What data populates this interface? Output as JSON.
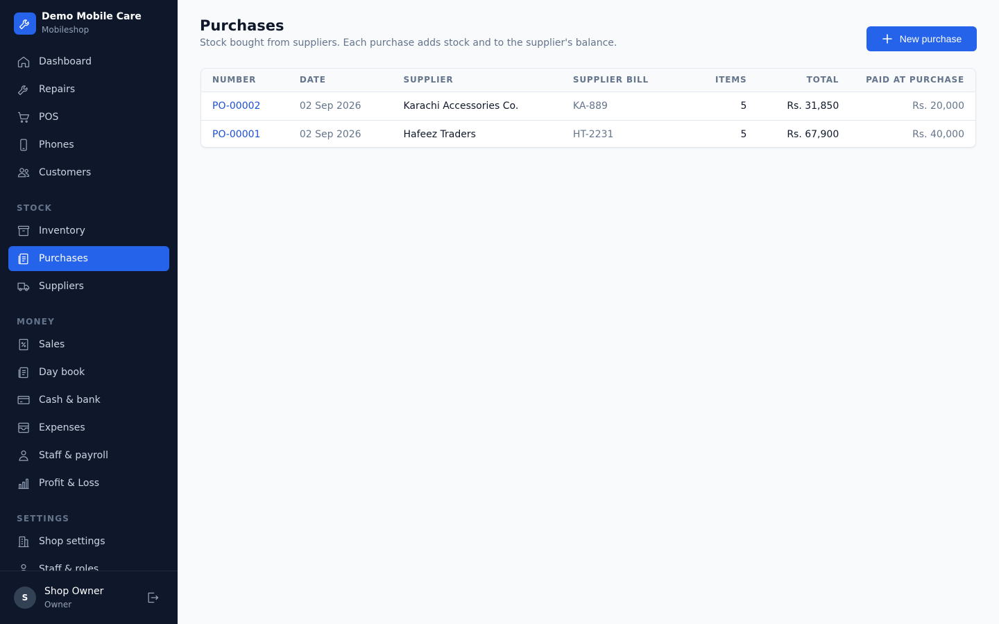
{
  "brand": {
    "name": "Demo Mobile Care",
    "subtitle": "Mobileshop"
  },
  "sidebar": {
    "main_items": [
      {
        "label": "Dashboard",
        "icon": "home-icon"
      },
      {
        "label": "Repairs",
        "icon": "wrench-icon"
      },
      {
        "label": "POS",
        "icon": "cart-icon"
      },
      {
        "label": "Phones",
        "icon": "phone-icon"
      },
      {
        "label": "Customers",
        "icon": "users-icon"
      }
    ],
    "stock_label": "STOCK",
    "stock_items": [
      {
        "label": "Inventory",
        "icon": "archive-icon"
      },
      {
        "label": "Purchases",
        "icon": "clipboard-icon",
        "active": true
      },
      {
        "label": "Suppliers",
        "icon": "truck-icon"
      }
    ],
    "money_label": "MONEY",
    "money_items": [
      {
        "label": "Sales",
        "icon": "receipt-icon"
      },
      {
        "label": "Day book",
        "icon": "book-icon"
      },
      {
        "label": "Cash & bank",
        "icon": "credit-card-icon"
      },
      {
        "label": "Expenses",
        "icon": "wallet-icon"
      },
      {
        "label": "Staff & payroll",
        "icon": "user-icon"
      },
      {
        "label": "Profit & Loss",
        "icon": "bar-chart-icon"
      }
    ],
    "settings_label": "SETTINGS",
    "settings_items": [
      {
        "label": "Shop settings",
        "icon": "building-icon"
      },
      {
        "label": "Staff & roles",
        "icon": "user-icon"
      }
    ]
  },
  "user": {
    "initial": "S",
    "name": "Shop Owner",
    "role": "Owner"
  },
  "page": {
    "title": "Purchases",
    "subtitle": "Stock bought from suppliers. Each purchase adds stock and to the supplier's balance.",
    "new_button": "New purchase"
  },
  "table": {
    "columns": [
      "NUMBER",
      "DATE",
      "SUPPLIER",
      "SUPPLIER BILL",
      "ITEMS",
      "TOTAL",
      "PAID AT PURCHASE"
    ],
    "rows": [
      {
        "number": "PO-00002",
        "date": "02 Sep 2026",
        "supplier": "Karachi Accessories Co.",
        "bill": "KA-889",
        "items": "5",
        "total": "Rs. 31,850",
        "paid": "Rs. 20,000"
      },
      {
        "number": "PO-00001",
        "date": "02 Sep 2026",
        "supplier": "Hafeez Traders",
        "bill": "HT-2231",
        "items": "5",
        "total": "Rs. 67,900",
        "paid": "Rs. 40,000"
      }
    ]
  },
  "colors": {
    "sidebar_bg": "#0f172a",
    "accent": "#2563eb",
    "page_bg": "#f8fafc"
  }
}
